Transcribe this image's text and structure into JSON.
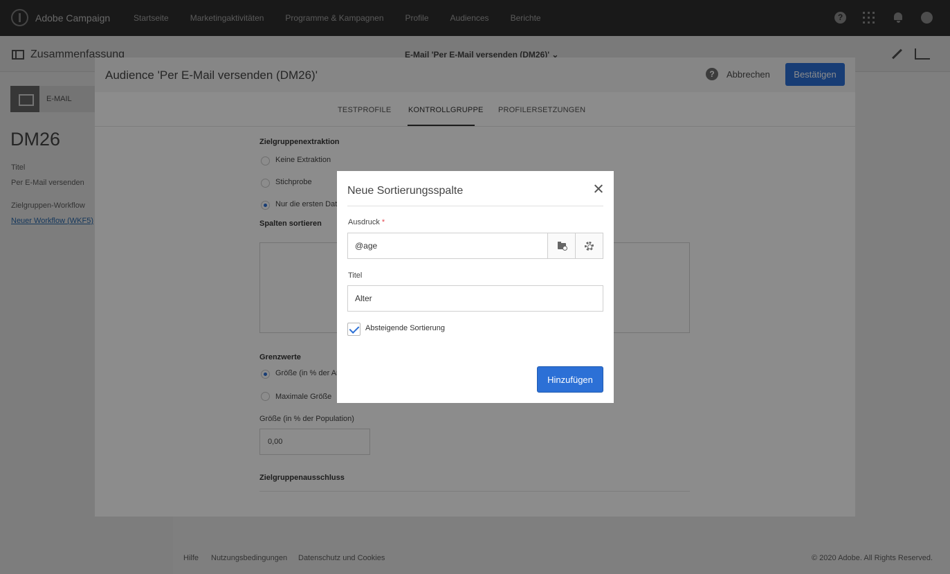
{
  "topnav": {
    "brand": "Adobe Campaign",
    "links": [
      "Startseite",
      "Marketingaktivitäten",
      "Programme & Kampagnen",
      "Profile",
      "Audiences",
      "Berichte"
    ],
    "help_glyph": "?"
  },
  "subheader": {
    "title": "Zusammenfassung",
    "center": "E-Mail 'Per E-Mail versenden (DM26)' ⌄"
  },
  "left": {
    "card_label": "E-MAIL",
    "delivery_code": "DM26",
    "title_label": "Titel",
    "title_value": "Per E-Mail versenden",
    "workflow_label": "Zielgruppen-Workflow",
    "workflow_link": "Neuer Workflow (WKF5)"
  },
  "footer": {
    "links": [
      "Hilfe",
      "Nutzungsbedingungen",
      "Datenschutz und Cookies"
    ],
    "copyright": "© 2020 Adobe. All Rights Reserved."
  },
  "audience": {
    "title": "Audience 'Per E-Mail versenden (DM26)'",
    "help_glyph": "?",
    "cancel": "Abbrechen",
    "confirm": "Bestätigen",
    "tabs": [
      "TESTPROFILE",
      "KONTROLLGRUPPE",
      "PROFILERSETZUNGEN"
    ],
    "extraction_label": "Zielgruppenextraktion",
    "extraction_options": [
      "Keine Extraktion",
      "Stichprobe",
      "Nur die ersten Daten"
    ],
    "sort_label": "Spalten sortieren",
    "limits_label": "Grenzwerte",
    "limit_options": [
      "Größe (in % der Anzahl)",
      "Maximale Größe"
    ],
    "size_label": "Größe (in % der Population)",
    "size_value": "0,00",
    "exclusion_label": "Zielgruppenausschluss"
  },
  "modal": {
    "title": "Neue Sortierungsspalte",
    "expression_label": "Ausdruck",
    "required_mark": "*",
    "expression_value": "@age",
    "title_label": "Titel",
    "title_value": "Alter",
    "descending_label": "Absteigende Sortierung",
    "add_button": "Hinzufügen"
  }
}
